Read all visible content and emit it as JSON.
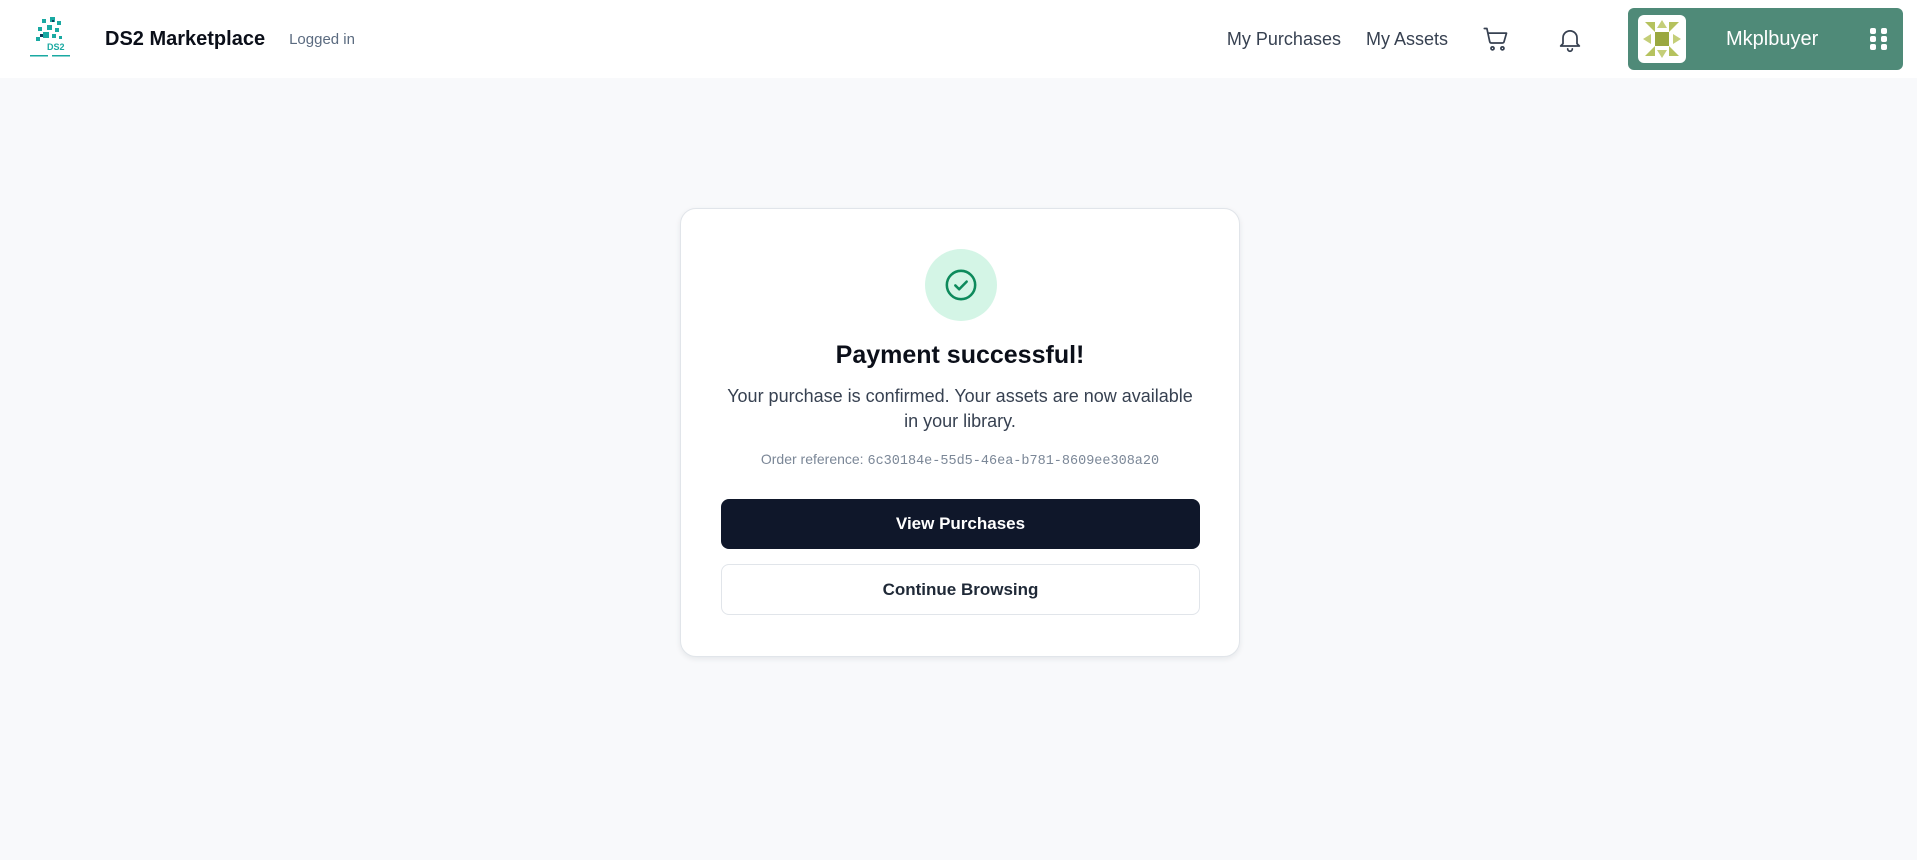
{
  "header": {
    "brand_title": "DS2 Marketplace",
    "status_text": "Logged in",
    "logo_text": "DS2",
    "nav": {
      "purchases_label": "My Purchases",
      "assets_label": "My Assets"
    },
    "icons": {
      "cart": "shopping-cart-icon",
      "notifications": "bell-icon",
      "apps": "grid-icon"
    },
    "user": {
      "name": "Mkplbuyer"
    }
  },
  "confirmation": {
    "title": "Payment successful!",
    "message": "Your purchase is confirmed. Your assets are now available in your library.",
    "order_reference_label": "Order reference:",
    "order_reference_value": "6c30184e-55d5-46ea-b781-8609ee308a20",
    "primary_button_label": "View Purchases",
    "secondary_button_label": "Continue Browsing"
  },
  "colors": {
    "page_bg": "#f8f9fb",
    "user_chip_bg": "#4f8a78",
    "primary_button_bg": "#0f172a",
    "success_circle_bg": "#d4f5e6",
    "success_check": "#0e8a5c",
    "logo_teal": "#1aa9a2"
  }
}
